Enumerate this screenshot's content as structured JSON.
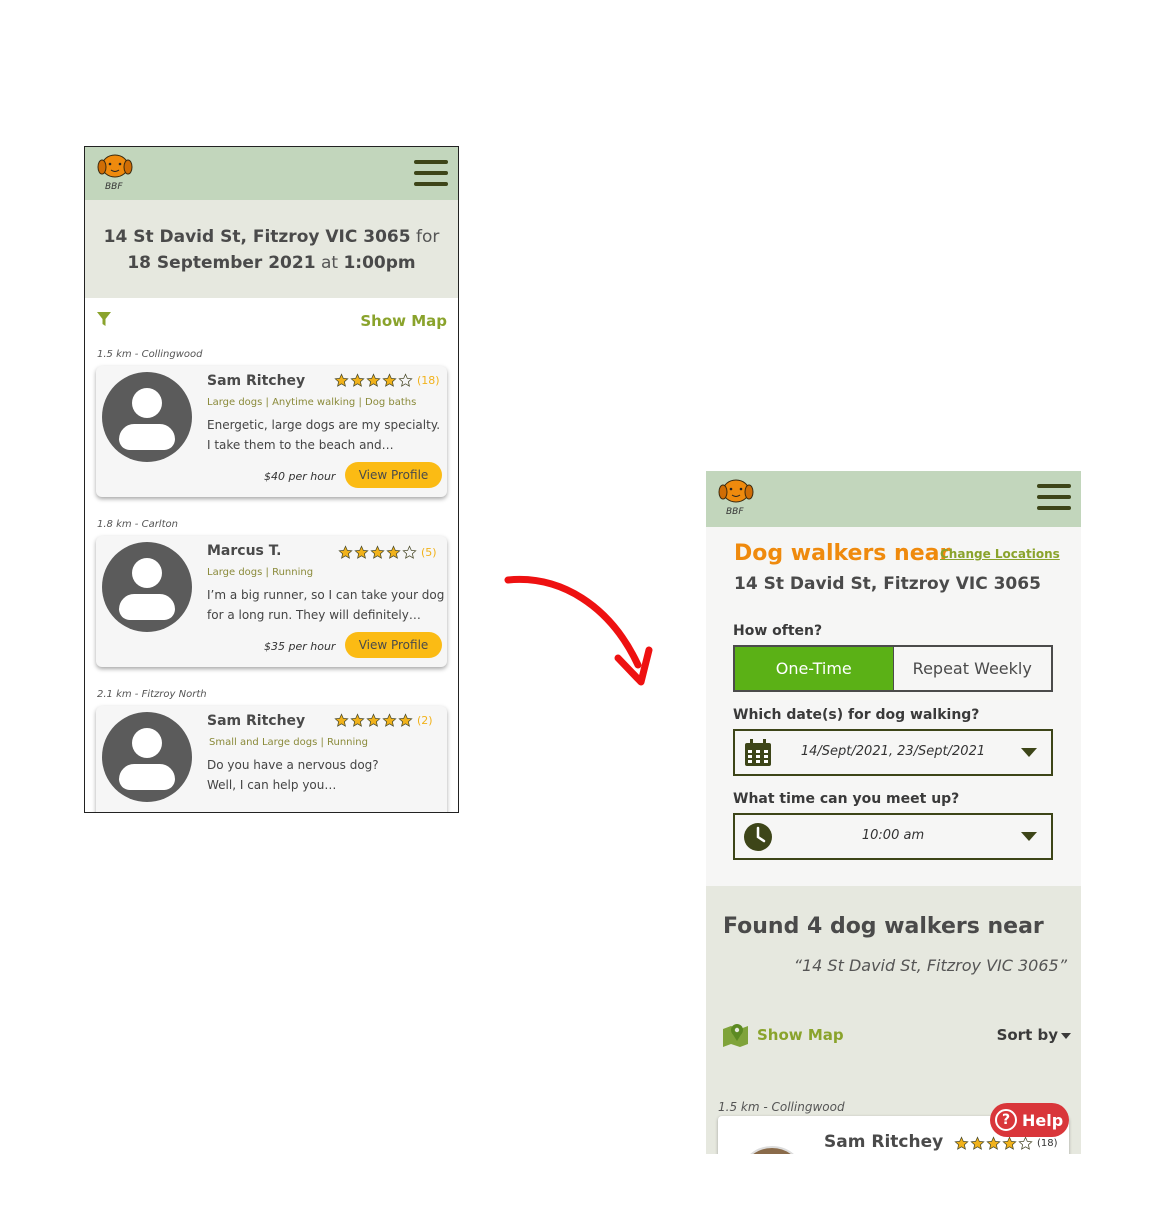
{
  "colors": {
    "header": "#c2d6bc",
    "accent_green": "#8aa32c",
    "button_yellow": "#fbbb14",
    "star": "#f1b21b",
    "orange": "#ef8a0d",
    "toggle_on": "#5bb116",
    "help_red": "#d9363a"
  },
  "left": {
    "logo_text": "BBF",
    "search": {
      "address": "14 St David St, Fitzroy VIC 3065",
      "for_word": "for",
      "date": "18 September 2021",
      "at_word": "at",
      "time": "1:00pm"
    },
    "show_map": "Show Map",
    "walkers": [
      {
        "distance": "1.5 km - Collingwood",
        "name": "Sam Ritchey",
        "rating": 4,
        "count": "(18)",
        "tags": "Large dogs | Anytime walking | Dog baths",
        "bio": "Energetic, large dogs are my specialty. I take them to the beach and…",
        "price": "$40 per hour",
        "button": "View Profile"
      },
      {
        "distance": "1.8 km - Carlton",
        "name": "Marcus T.",
        "rating": 4,
        "count": "(5)",
        "tags": "Large dogs | Running",
        "bio": "I’m a big runner, so I can take your dog for a long run. They will definitely…",
        "price": "$35 per hour",
        "button": "View Profile"
      },
      {
        "distance": "2.1 km - Fitzroy North",
        "name": "Sam Ritchey",
        "rating": 5,
        "count": "(2)",
        "tags": "Small and Large dogs | Running",
        "bio": "Do you have a nervous dog? Well, I can help you…",
        "price": "",
        "button": ""
      }
    ]
  },
  "right": {
    "logo_text": "BBF",
    "title": "Dog walkers near",
    "change_locations": "Change Locations",
    "address": "14 St David St, Fitzroy VIC 3065",
    "how_often": {
      "label": "How often?",
      "options": [
        "One-Time",
        "Repeat Weekly"
      ],
      "selected": "One-Time"
    },
    "dates": {
      "label": "Which date(s) for dog walking?",
      "value": "14/Sept/2021, 23/Sept/2021",
      "icon": "calendar-icon"
    },
    "time": {
      "label": "What time can you meet up?",
      "value": "10:00 am",
      "icon": "clock-icon"
    },
    "found": {
      "title": "Found 4 dog walkers near",
      "address": "“14 St David St, Fitzroy VIC 3065”"
    },
    "show_map": "Show Map",
    "sort_by": "Sort by",
    "first_walker": {
      "distance": "1.5 km - Collingwood",
      "name": "Sam Ritchey",
      "rating": 4,
      "count": "(18)"
    },
    "help": "Help"
  }
}
